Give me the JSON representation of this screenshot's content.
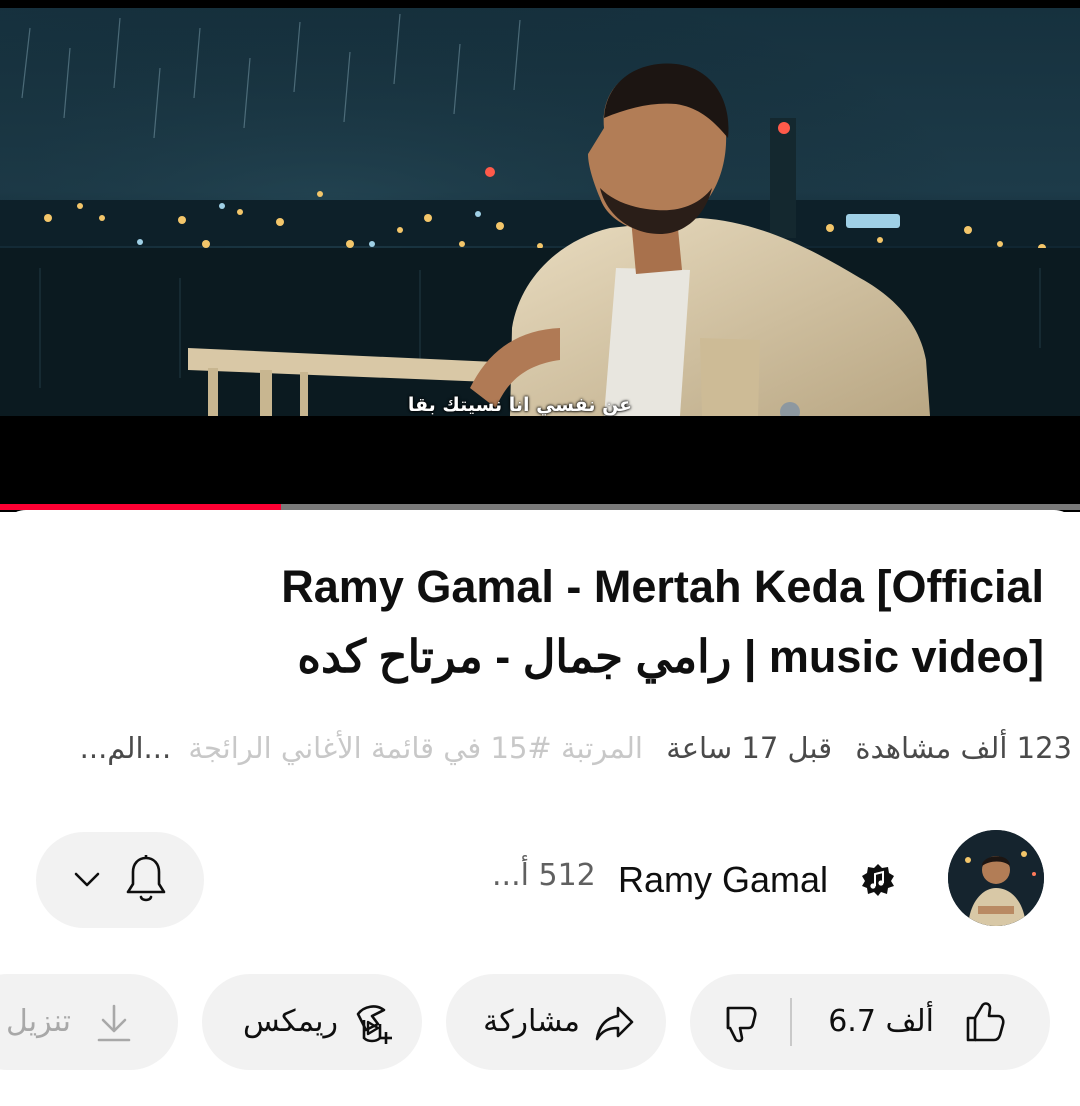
{
  "video": {
    "subtitle": "عن نفسي انا نسيتك بقا",
    "progress_fraction": 0.26
  },
  "title": "Ramy Gamal - Mertah Keda [Official music video] | رامي جمال - مرتاح كده",
  "meta": {
    "views": "123 ألف مشاهدة",
    "age": "قبل 17 ساعة",
    "trending": "المرتبة #15 في قائمة الأغاني الرائجة",
    "more": "...الم..."
  },
  "channel": {
    "name": "Ramy Gamal",
    "subscribers": "512 أ...",
    "verified_icon": "music-note-badge-icon"
  },
  "actions": {
    "like_count": "6.7 ألف",
    "share_label": "مشاركة",
    "remix_label": "ريمكس",
    "download_label": "تنزيل"
  },
  "colors": {
    "progress": "#ff0033",
    "pill_bg": "#f2f2f2"
  },
  "icons": {
    "like": "thumbs-up-icon",
    "dislike": "thumbs-down-icon",
    "share": "share-arrow-icon",
    "remix": "remix-icon",
    "download": "download-icon",
    "bell": "bell-icon",
    "chevron": "chevron-down-icon"
  }
}
